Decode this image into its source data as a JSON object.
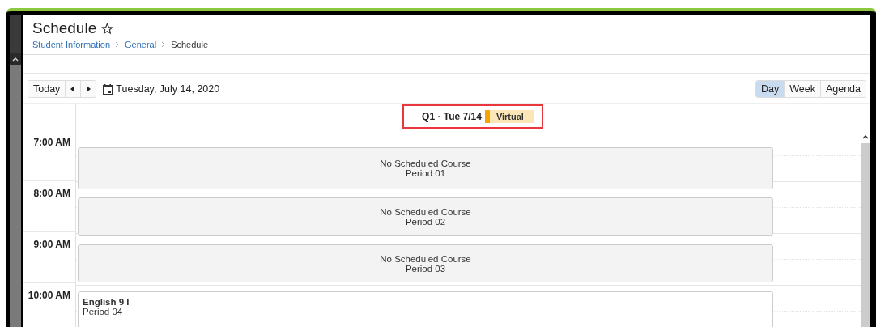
{
  "page": {
    "title": "Schedule",
    "favorite": false
  },
  "breadcrumb": [
    {
      "label": "Student Information",
      "link": true
    },
    {
      "label": "General",
      "link": true
    },
    {
      "label": "Schedule",
      "link": false
    }
  ],
  "toolbar": {
    "today": "Today",
    "date": "Tuesday, July 14, 2020",
    "views": [
      {
        "label": "Day",
        "selected": true
      },
      {
        "label": "Week",
        "selected": false
      },
      {
        "label": "Agenda",
        "selected": false
      }
    ]
  },
  "day_header": {
    "label": "Q1 - Tue 7/14",
    "tag": "Virtual",
    "highlighted": true
  },
  "hours": [
    "7:00 AM",
    "8:00 AM",
    "9:00 AM",
    "10:00 AM"
  ],
  "events": [
    {
      "kind": "empty",
      "title": "No Scheduled Course",
      "period": "Period 01"
    },
    {
      "kind": "empty",
      "title": "No Scheduled Course",
      "period": "Period 02"
    },
    {
      "kind": "empty",
      "title": "No Scheduled Course",
      "period": "Period 03"
    },
    {
      "kind": "course",
      "title": "English 9 I",
      "period": "Period 04"
    }
  ]
}
